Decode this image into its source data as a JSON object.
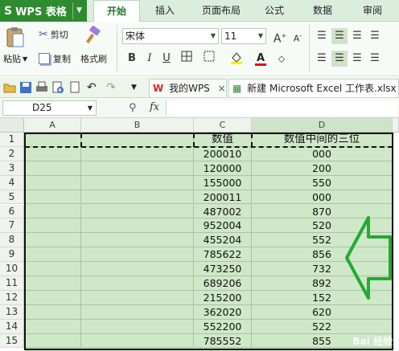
{
  "app": {
    "name": "WPS 表格",
    "logo": "S"
  },
  "menu": {
    "tabs": [
      {
        "label": "开始",
        "active": true
      },
      {
        "label": "插入"
      },
      {
        "label": "页面布局"
      },
      {
        "label": "公式"
      },
      {
        "label": "数据"
      },
      {
        "label": "审阅"
      }
    ]
  },
  "ribbon": {
    "paste": "粘贴",
    "cut": "剪切",
    "copy": "复制",
    "format_painter": "格式刷",
    "font_name": "宋体",
    "font_size": "11",
    "bold": "B",
    "italic": "I",
    "underline": "U"
  },
  "docs": {
    "tab1": "我的WPS",
    "tab2": "新建 Microsoft Excel 工作表.xlsx"
  },
  "formula_bar": {
    "cell_ref": "D25",
    "fx": "fx"
  },
  "columns": [
    "A",
    "B",
    "C",
    "D"
  ],
  "rows": [
    {
      "n": "1",
      "c": "数值",
      "d": "数值中间的三位"
    },
    {
      "n": "2",
      "c": "200010",
      "d": "000"
    },
    {
      "n": "3",
      "c": "120000",
      "d": "200"
    },
    {
      "n": "4",
      "c": "155000",
      "d": "550"
    },
    {
      "n": "5",
      "c": "200011",
      "d": "000"
    },
    {
      "n": "6",
      "c": "487002",
      "d": "870"
    },
    {
      "n": "7",
      "c": "952004",
      "d": "520"
    },
    {
      "n": "8",
      "c": "455204",
      "d": "552"
    },
    {
      "n": "9",
      "c": "785622",
      "d": "856"
    },
    {
      "n": "10",
      "c": "473250",
      "d": "732"
    },
    {
      "n": "11",
      "c": "689206",
      "d": "892"
    },
    {
      "n": "12",
      "c": "215200",
      "d": "152"
    },
    {
      "n": "13",
      "c": "362020",
      "d": "620"
    },
    {
      "n": "14",
      "c": "552200",
      "d": "522"
    },
    {
      "n": "15",
      "c": "785552",
      "d": "855"
    }
  ],
  "watermark": "Bai 经验",
  "colors": {
    "accent": "#2e8b2f",
    "cell_fill": "#cfe8c8",
    "arrow": "#22aa33"
  }
}
